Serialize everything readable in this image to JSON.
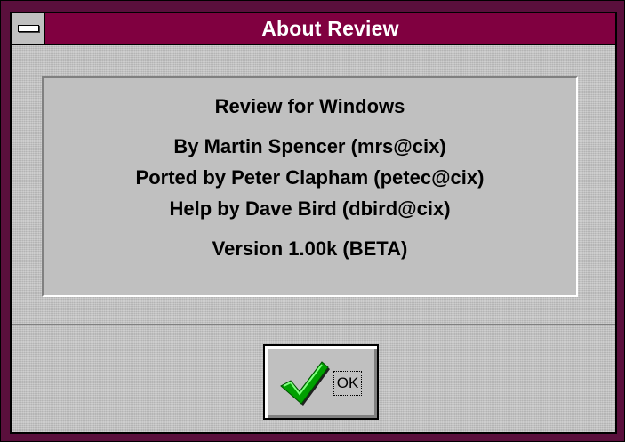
{
  "window": {
    "title": "About Review"
  },
  "info": {
    "app_name": "Review for Windows",
    "author": "By Martin Spencer (mrs@cix)",
    "porter": "Ported by Peter Clapham (petec@cix)",
    "help": "Help by Dave Bird (dbird@cix)",
    "version": "Version 1.00k (BETA)"
  },
  "buttons": {
    "ok_label": "OK",
    "ok_icon": "checkmark-icon"
  },
  "colors": {
    "title_bar": "#800040",
    "frame": "#5a0f3c",
    "face": "#c0c0c0",
    "check_green": "#00a000"
  }
}
